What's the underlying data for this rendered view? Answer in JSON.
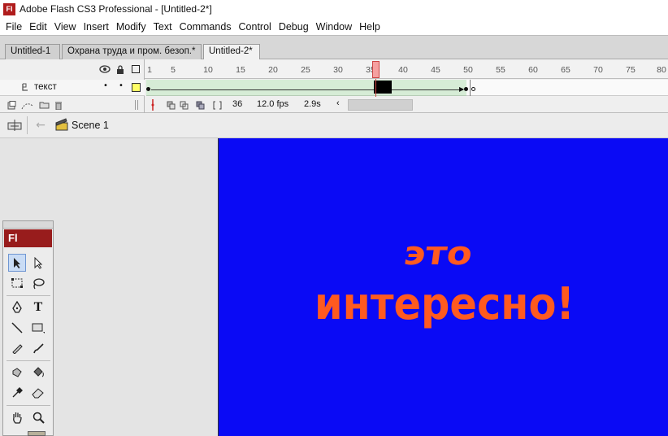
{
  "window": {
    "title": "Adobe Flash CS3 Professional - [Untitled-2*]",
    "logo": "Fl"
  },
  "menu": [
    "File",
    "Edit",
    "View",
    "Insert",
    "Modify",
    "Text",
    "Commands",
    "Control",
    "Debug",
    "Window",
    "Help"
  ],
  "tabs": [
    {
      "label": "Untitled-1",
      "active": false
    },
    {
      "label": "Охрана труда и пром. безоп.*",
      "active": false
    },
    {
      "label": "Untitled-2*",
      "active": true
    }
  ],
  "timeline": {
    "ruler": [
      "1",
      "5",
      "10",
      "15",
      "20",
      "25",
      "30",
      "35",
      "40",
      "45",
      "50",
      "55",
      "60",
      "65",
      "70",
      "75",
      "80"
    ],
    "layer_name": "текст",
    "current_frame": "36",
    "fps": "12.0 fps",
    "elapsed": "2.9s"
  },
  "editbar": {
    "scene": "Scene 1"
  },
  "tools_panel": {
    "header": "Fl"
  },
  "stage": {
    "background": "#0a0af5",
    "text_color": "#ff5a1f",
    "line1": "это",
    "line2": "интересно!"
  }
}
